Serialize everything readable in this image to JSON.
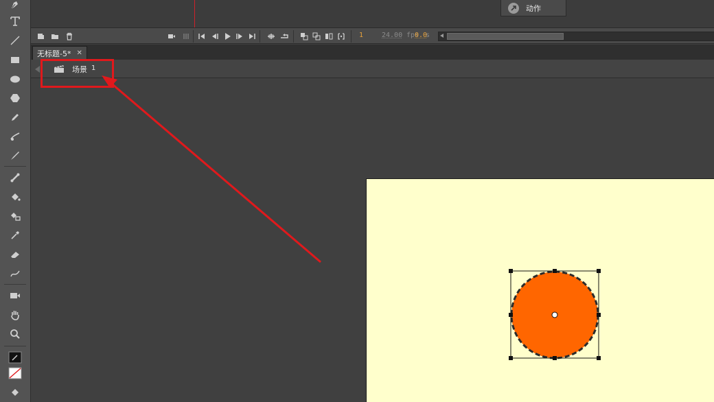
{
  "colors": {
    "toolbar_bg": "#535353",
    "panel_bg": "#4a4a4a",
    "canvas_bg": "#404040",
    "stage_bg": "#ffffcc",
    "circle_fill": "#ff6600",
    "accent_value": "#e8a23a",
    "annotation_red": "#e0191c"
  },
  "actions_panel": {
    "icon": "actions-icon",
    "label": "动作"
  },
  "timeline_controls": {
    "current_frame": "1",
    "fps_value": "24.00",
    "fps_unit": "fps",
    "time_value": "0.0",
    "time_unit": "s"
  },
  "document": {
    "tab_title": "无标题-5*",
    "close_glyph": "✕"
  },
  "scene": {
    "icon": "clapperboard-icon",
    "label": "场景",
    "number": "1"
  },
  "tools": [
    "pen-tool-icon",
    "text-tool-icon",
    "line-tool-icon",
    "rectangle-tool-icon",
    "oval-tool-icon",
    "polystar-tool-icon",
    "pencil-tool-icon",
    "paint-brush-tool-icon",
    "brush-tool-icon",
    "bone-tool-icon",
    "paint-bucket-tool-icon",
    "ink-bottle-tool-icon",
    "eyedropper-tool-icon",
    "eraser-tool-icon",
    "width-tool-icon",
    "camera-tool-icon",
    "hand-tool-icon",
    "zoom-tool-icon",
    "stroke-color-icon",
    "fill-color-icon",
    "fill-bucket-icon"
  ]
}
